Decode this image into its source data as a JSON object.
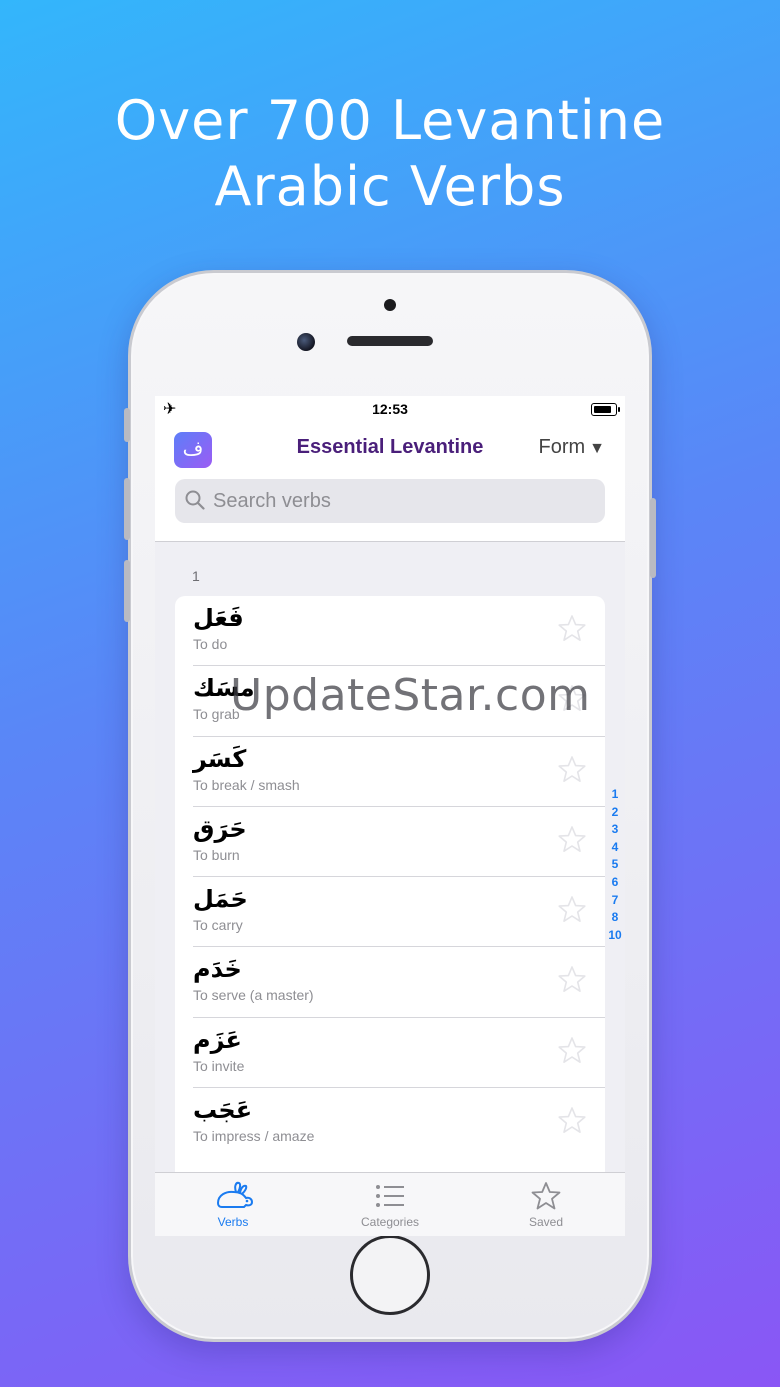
{
  "headline": {
    "line1": "Over 700 Levantine",
    "line2": "Arabic Verbs"
  },
  "status_bar": {
    "time": "12:53",
    "airplane_glyph": "✈"
  },
  "navbar": {
    "app_icon_glyph": "ف",
    "title": "Essential Levantine",
    "form_label": "Form",
    "form_caret": "▼"
  },
  "search": {
    "placeholder": "Search verbs"
  },
  "section": {
    "header": "1"
  },
  "verbs": [
    {
      "arabic": "فَعَل",
      "english": "To do"
    },
    {
      "arabic": "مسَك",
      "english": "To grab"
    },
    {
      "arabic": "كَسَر",
      "english": "To break / smash"
    },
    {
      "arabic": "حَرَق",
      "english": "To burn"
    },
    {
      "arabic": "حَمَل",
      "english": "To carry"
    },
    {
      "arabic": "خَدَم",
      "english": "To serve (a master)"
    },
    {
      "arabic": "عَزَم",
      "english": "To invite"
    },
    {
      "arabic": "عَجَب",
      "english": "To impress / amaze"
    }
  ],
  "index": [
    "1",
    "2",
    "3",
    "4",
    "5",
    "6",
    "7",
    "8",
    "10"
  ],
  "watermark": "UpdateStar.com",
  "tabs": [
    {
      "label": "Verbs",
      "icon": "rabbit-icon",
      "active": true
    },
    {
      "label": "Categories",
      "icon": "list-icon",
      "active": false
    },
    {
      "label": "Saved",
      "icon": "star-icon",
      "active": false
    }
  ],
  "colors": {
    "accent": "#1a7bf0",
    "title": "#4a1f7a",
    "inactive_tab": "#8e8e93"
  }
}
